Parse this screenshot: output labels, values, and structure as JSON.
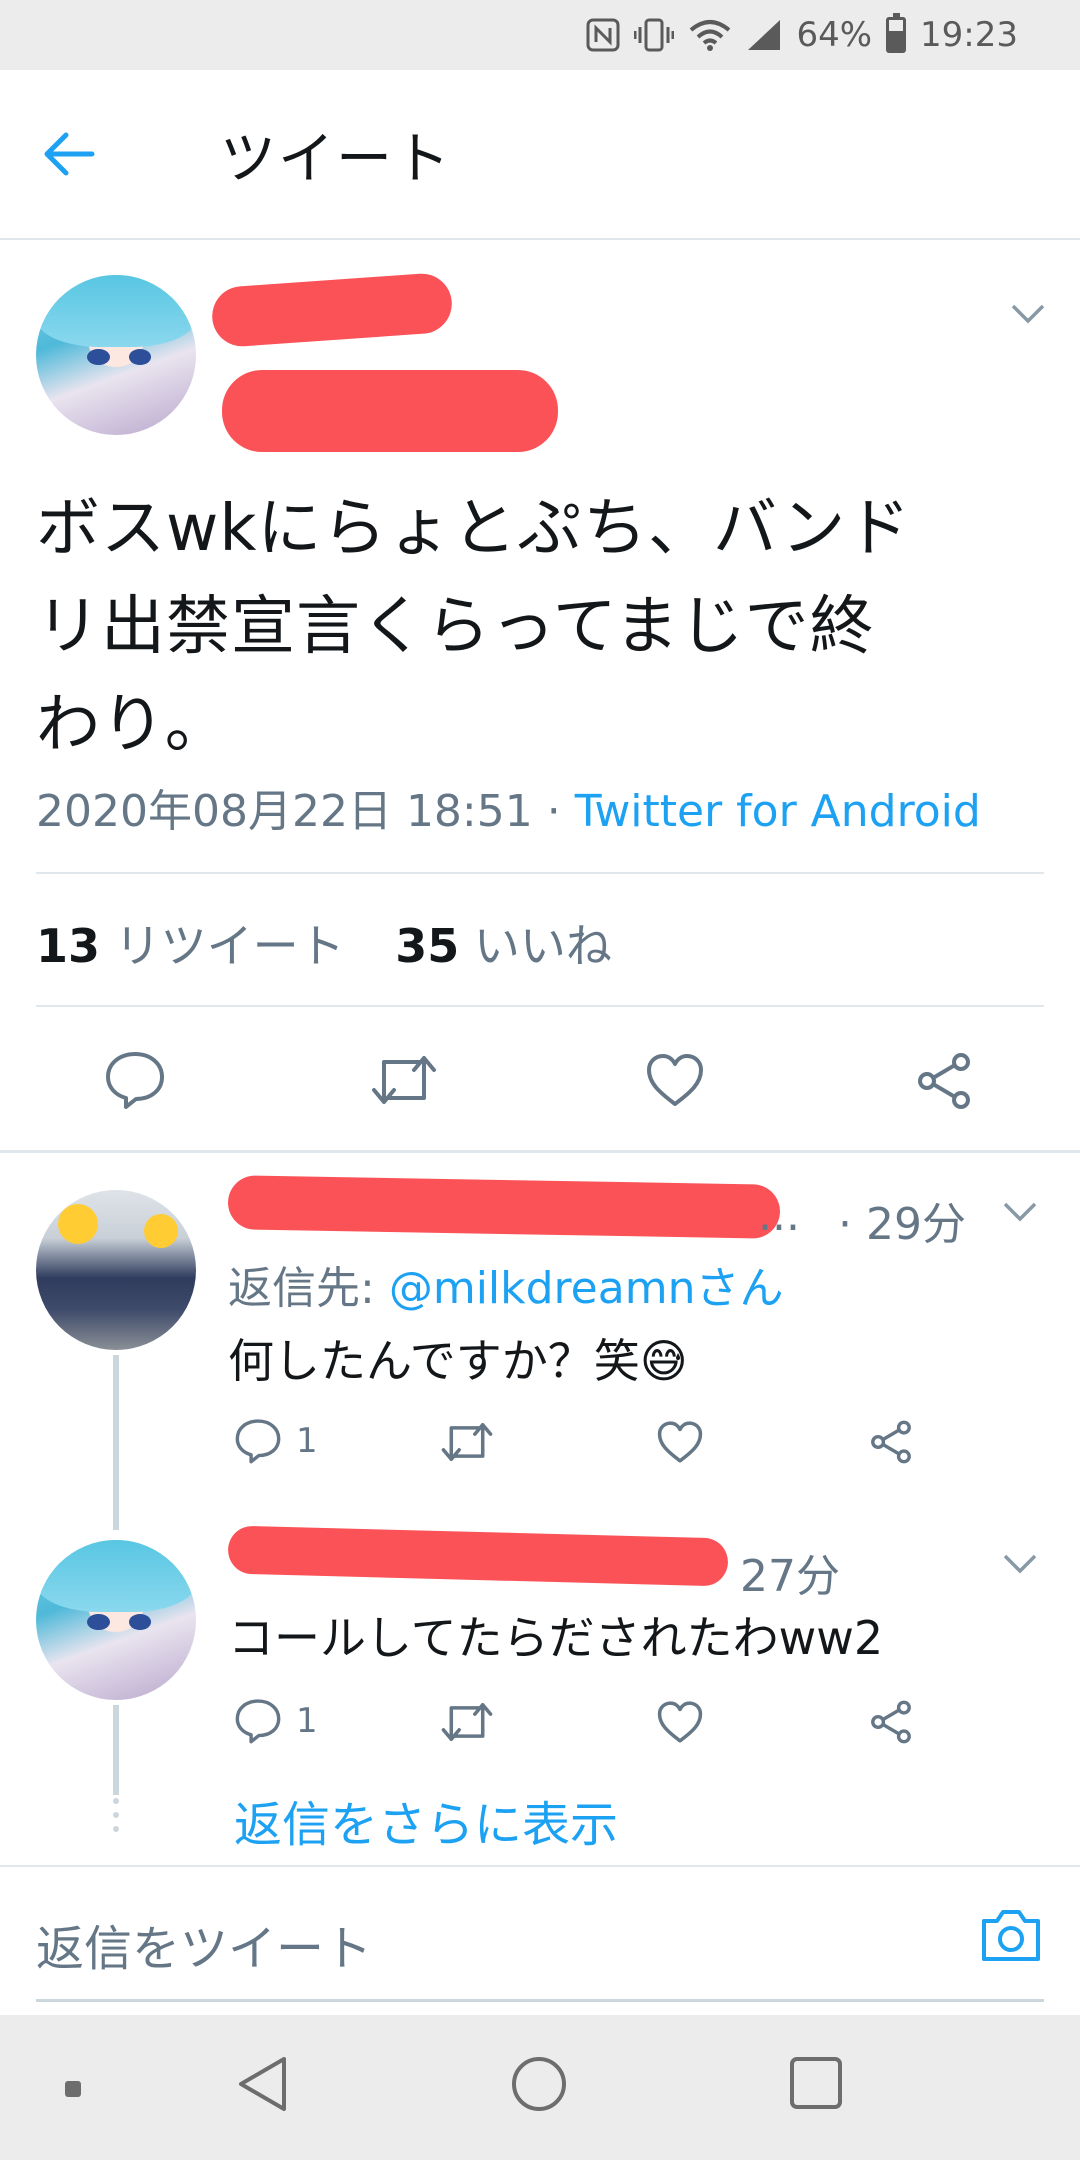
{
  "status_bar": {
    "battery": "64%",
    "battery_level": 0.64,
    "time": "19:23"
  },
  "header": {
    "title": "ツイート"
  },
  "tweet": {
    "text_lines": [
      "ボスwkにらょとぷち、バンド",
      "リ出禁宣言くらってまじで終",
      "わり。"
    ],
    "date": "2020年08月22日 18:51",
    "separator": " · ",
    "source": "Twitter for Android",
    "retweet_count": "13",
    "retweet_label": "リツイート",
    "like_count": "35",
    "like_label": "いいね"
  },
  "replies": [
    {
      "name_tail": "...",
      "time": "· 29分",
      "reply_to_prefix": "返信先:",
      "reply_to_handle": "@milkdreamnさん",
      "text": "何したんですか？笑😅",
      "reply_count": "1"
    },
    {
      "time": "27分",
      "text": "コールしてたらだされたわww2",
      "reply_count": "1"
    }
  ],
  "show_more": "返信をさらに表示",
  "compose": {
    "placeholder": "返信をツイート"
  },
  "colors": {
    "accent": "#1da1f2",
    "muted": "#657786",
    "redaction": "#fb5257"
  }
}
